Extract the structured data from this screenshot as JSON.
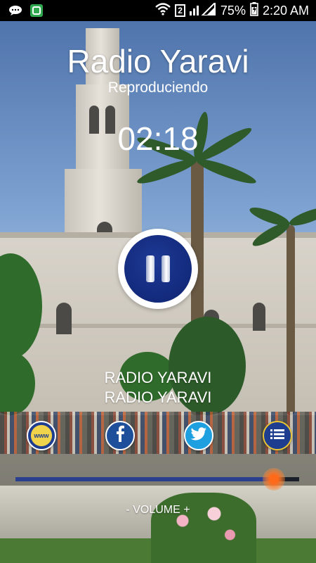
{
  "status_bar": {
    "signal_percent": "75%",
    "sim_slot": "2",
    "time": "2:20 AM",
    "icons": [
      "chat-bubble-icon",
      "whatsapp-icon",
      "wifi-icon",
      "signal-icon",
      "battery-icon"
    ]
  },
  "player": {
    "station_title": "Radio Yaravi",
    "status": "Reproduciendo",
    "elapsed": "02:18",
    "button_state": "pause",
    "track_line1": "RADIO YARAVI",
    "track_line2": "RADIO YARAVI"
  },
  "social": {
    "www_label": "www",
    "buttons": [
      "www-icon",
      "facebook-icon",
      "twitter-icon",
      "menu-list-icon"
    ]
  },
  "volume": {
    "label": "- VOLUME +",
    "level": 0.91
  },
  "colors": {
    "accent": "#1e3d8f",
    "knob": "#ff6a1a",
    "facebook": "#1d4f9a",
    "twitter": "#1e9fe0"
  }
}
